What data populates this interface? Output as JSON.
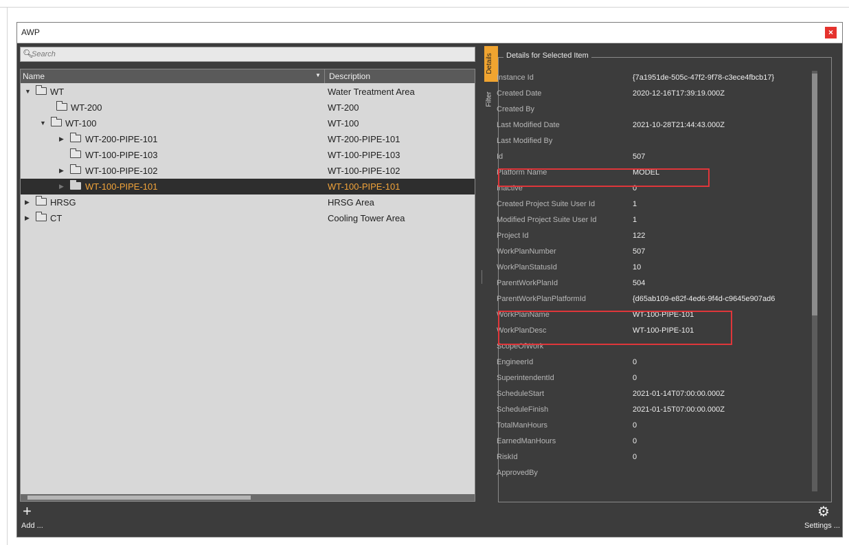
{
  "window": {
    "title": "AWP",
    "close_label": "×"
  },
  "search": {
    "placeholder": "Search",
    "value": ""
  },
  "tree": {
    "headers": {
      "name": "Name",
      "description": "Description"
    },
    "rows": [
      {
        "label": "WT",
        "description": "Water Treatment Area",
        "caret": "▼"
      },
      {
        "label": "WT-200",
        "description": "WT-200",
        "caret": ""
      },
      {
        "label": "WT-100",
        "description": "WT-100",
        "caret": "▼"
      },
      {
        "label": "WT-200-PIPE-101",
        "description": "WT-200-PIPE-101",
        "caret": "▶"
      },
      {
        "label": "WT-100-PIPE-103",
        "description": "WT-100-PIPE-103",
        "caret": ""
      },
      {
        "label": "WT-100-PIPE-102",
        "description": "WT-100-PIPE-102",
        "caret": "▶"
      },
      {
        "label": "WT-100-PIPE-101",
        "description": "WT-100-PIPE-101",
        "caret": "▶"
      },
      {
        "label": "HRSG",
        "description": "HRSG Area",
        "caret": "▶"
      },
      {
        "label": "CT",
        "description": "Cooling Tower Area",
        "caret": "▶"
      }
    ],
    "selected": "WT-100-PIPE-101"
  },
  "tabs": {
    "details": "Details",
    "filter": "Filter"
  },
  "details": {
    "title": "Details for Selected Item",
    "rows": [
      {
        "label": "Instance Id",
        "value": "{7a1951de-505c-47f2-9f78-c3ece4fbcb17}"
      },
      {
        "label": "Created Date",
        "value": "2020-12-16T17:39:19.000Z"
      },
      {
        "label": "Created By",
        "value": ""
      },
      {
        "label": "Last Modified Date",
        "value": "2021-10-28T21:44:43.000Z"
      },
      {
        "label": "Last Modified By",
        "value": ""
      },
      {
        "label": "Id",
        "value": "507"
      },
      {
        "label": "Platform Name",
        "value": "MODEL"
      },
      {
        "label": "Inactive",
        "value": "0"
      },
      {
        "label": "Created Project Suite User Id",
        "value": "1"
      },
      {
        "label": "Modified Project Suite User Id",
        "value": "1"
      },
      {
        "label": "Project Id",
        "value": "122"
      },
      {
        "label": "WorkPlanNumber",
        "value": "507"
      },
      {
        "label": "WorkPlanStatusId",
        "value": "10"
      },
      {
        "label": "ParentWorkPlanId",
        "value": "504"
      },
      {
        "label": "ParentWorkPlanPlatformId",
        "value": "{d65ab109-e82f-4ed6-9f4d-c9645e907ad6"
      },
      {
        "label": "WorkPlanName",
        "value": "WT-100-PIPE-101"
      },
      {
        "label": "WorkPlanDesc",
        "value": "WT-100-PIPE-101"
      },
      {
        "label": "ScopeOfWork",
        "value": ""
      },
      {
        "label": "EngineerId",
        "value": "0"
      },
      {
        "label": "SuperintendentId",
        "value": "0"
      },
      {
        "label": "ScheduleStart",
        "value": "2021-01-14T07:00:00.000Z"
      },
      {
        "label": "ScheduleFinish",
        "value": "2021-01-15T07:00:00.000Z"
      },
      {
        "label": "TotalManHours",
        "value": "0"
      },
      {
        "label": "EarnedManHours",
        "value": "0"
      },
      {
        "label": "RiskId",
        "value": "0"
      },
      {
        "label": "ApprovedBy",
        "value": ""
      }
    ]
  },
  "footer": {
    "add_label": "Add ...",
    "add_icon": "+",
    "settings_label": "Settings ...",
    "settings_icon": "⚙"
  },
  "colors": {
    "selected_text": "#f2a43a",
    "highlight_box": "#e0363a",
    "active_tab": "#f0a430"
  }
}
